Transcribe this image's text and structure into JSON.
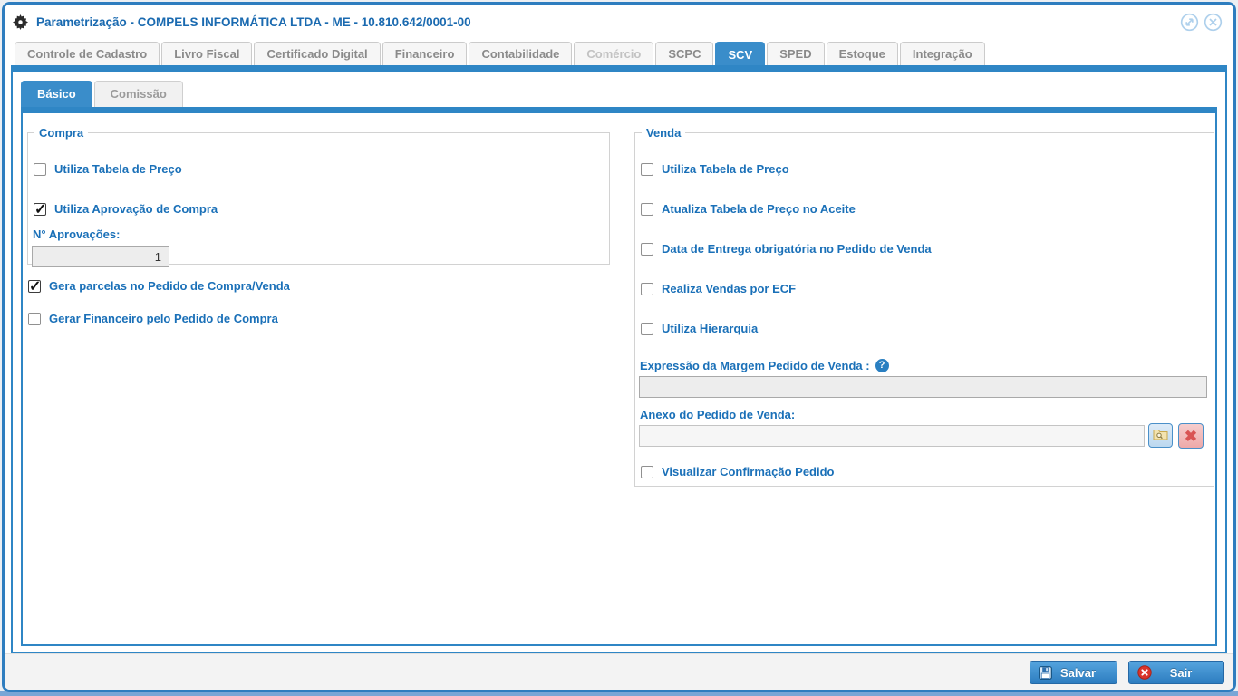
{
  "window": {
    "title": "Parametrização - COMPELS INFORMÁTICA LTDA - ME - 10.810.642/0001-00"
  },
  "colors": {
    "accent_blue": "#3a8dca",
    "bar_blue": "#2f86c5",
    "frame_blue": "#2e7dbf",
    "label_blue": "#1a70b8",
    "title_blue": "#1a6ab0",
    "danger_red": "#d93025",
    "clear_x_red": "#d95454"
  },
  "tabs": {
    "items": [
      {
        "label": "Controle de Cadastro"
      },
      {
        "label": "Livro Fiscal"
      },
      {
        "label": "Certificado Digital"
      },
      {
        "label": "Financeiro"
      },
      {
        "label": "Contabilidade"
      },
      {
        "label": "Comércio",
        "disabled": true
      },
      {
        "label": "SCPC"
      },
      {
        "label": "SCV",
        "active": true
      },
      {
        "label": "SPED"
      },
      {
        "label": "Estoque"
      },
      {
        "label": "Integração"
      }
    ]
  },
  "subtabs": {
    "items": [
      {
        "label": "Básico",
        "active": true
      },
      {
        "label": "Comissão"
      }
    ]
  },
  "compra": {
    "legend": "Compra",
    "checkboxes": [
      {
        "label": "Utiliza Tabela de Preço",
        "checked": false
      },
      {
        "label": "Utiliza Aprovação de Compra",
        "checked": true
      }
    ],
    "aprovacoes": {
      "label": "N° Aprovações:",
      "value": "1"
    }
  },
  "geral_checkboxes": [
    {
      "label": "Gera parcelas no Pedido de Compra/Venda",
      "checked": true
    },
    {
      "label": "Gerar Financeiro pelo Pedido de Compra",
      "checked": false
    }
  ],
  "venda": {
    "legend": "Venda",
    "checkboxes": [
      {
        "label": "Utiliza Tabela de Preço",
        "checked": false
      },
      {
        "label": "Atualiza Tabela de Preço no Aceite",
        "checked": false
      },
      {
        "label": "Data de Entrega obrigatória no Pedido de Venda",
        "checked": false
      },
      {
        "label": "Realiza Vendas por ECF",
        "checked": false
      },
      {
        "label": "Utiliza Hierarquia",
        "checked": false
      }
    ],
    "expressao": {
      "label": "Expressão da Margem Pedido de Venda :",
      "value": ""
    },
    "anexo": {
      "label": "Anexo do Pedido de Venda:",
      "value": ""
    },
    "visualizar": {
      "label": "Visualizar Confirmação Pedido",
      "checked": false
    }
  },
  "footer": {
    "salvar_label": "Salvar",
    "sair_label": "Sair"
  }
}
